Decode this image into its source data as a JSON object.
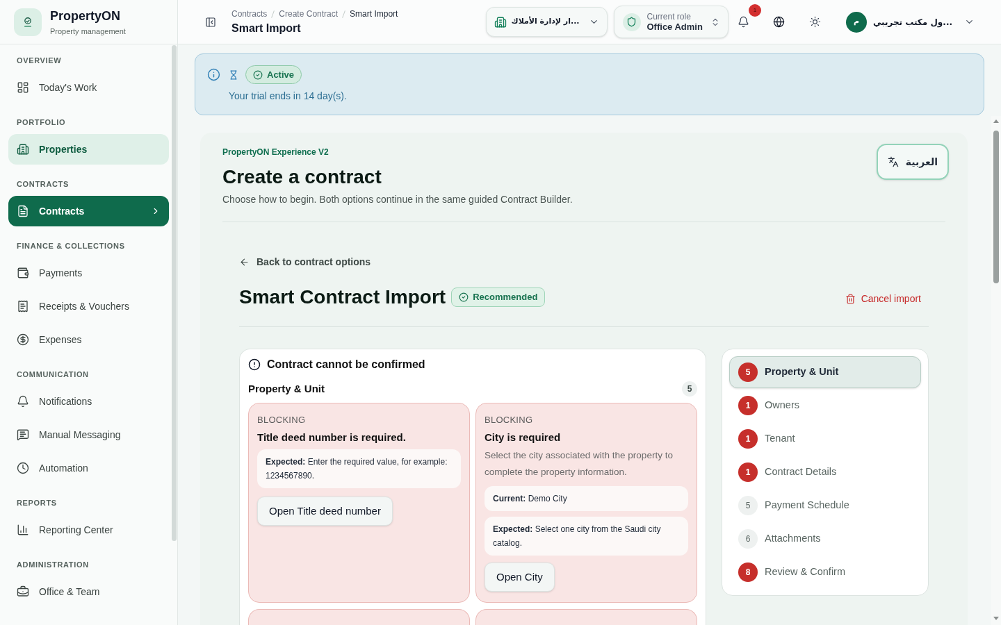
{
  "brand": {
    "name": "PropertyON",
    "tagline": "Property management"
  },
  "sidebar": {
    "sections": [
      {
        "heading": "OVERVIEW",
        "items": [
          {
            "label": "Today's Work",
            "selected": false,
            "highlighted": false
          }
        ]
      },
      {
        "heading": "PORTFOLIO",
        "items": [
          {
            "label": "Properties",
            "selected": false,
            "highlighted": true
          }
        ]
      },
      {
        "heading": "CONTRACTS",
        "items": [
          {
            "label": "Contracts",
            "selected": true,
            "highlighted": false
          }
        ]
      },
      {
        "heading": "FINANCE & COLLECTIONS",
        "items": [
          {
            "label": "Payments",
            "selected": false,
            "highlighted": false
          },
          {
            "label": "Receipts & Vouchers",
            "selected": false,
            "highlighted": false
          },
          {
            "label": "Expenses",
            "selected": false,
            "highlighted": false
          }
        ]
      },
      {
        "heading": "COMMUNICATION",
        "items": [
          {
            "label": "Notifications",
            "selected": false,
            "highlighted": false
          },
          {
            "label": "Manual Messaging",
            "selected": false,
            "highlighted": false
          },
          {
            "label": "Automation",
            "selected": false,
            "highlighted": false
          }
        ]
      },
      {
        "heading": "REPORTS",
        "items": [
          {
            "label": "Reporting Center",
            "selected": false,
            "highlighted": false
          }
        ]
      },
      {
        "heading": "ADMINISTRATION",
        "items": [
          {
            "label": "Office & Team",
            "selected": false,
            "highlighted": false
          }
        ]
      }
    ]
  },
  "header": {
    "breadcrumb": [
      {
        "label": "Contracts",
        "current": false
      },
      {
        "label": "Create Contract",
        "current": false
      },
      {
        "label": "Smart Import",
        "current": true
      }
    ],
    "title": "Smart Import",
    "office_selector": "...ار لإدارة الأملاك",
    "role": {
      "label": "Current role",
      "value": "Office Admin"
    },
    "notification_count": "1",
    "user": {
      "initial": "م",
      "name": "...ول مكتب تجريبي"
    }
  },
  "trial_banner": {
    "status": "Active",
    "message": "Your trial ends in 14 day(s)."
  },
  "page": {
    "eyebrow": "PropertyON Experience V2",
    "title": "Create a contract",
    "subtitle": "Choose how to begin. Both options continue in the same guided Contract Builder.",
    "language_button": "العربية"
  },
  "import": {
    "back_link": "Back to contract options",
    "title": "Smart Contract Import",
    "badge": "Recommended",
    "cancel_button": "Cancel import"
  },
  "validation": {
    "title": "Contract cannot be confirmed",
    "group": {
      "title": "Property & Unit",
      "count": "5"
    },
    "issues": [
      {
        "kind": "issue",
        "severity": "BLOCKING",
        "title": "Title deed number is required.",
        "details": [
          "**Expected:** Enter the required value, for example: 1234567890."
        ],
        "action": "Open Title deed number"
      },
      {
        "kind": "issue",
        "severity": "BLOCKING",
        "title": "City is required",
        "description": "Select the city associated with the property to complete the property information.",
        "details": [
          "**Current:** Demo City",
          "**Expected:** Select one city from the Saudi city catalog."
        ],
        "action": "Open City"
      },
      {
        "kind": "partial"
      },
      {
        "kind": "partial"
      }
    ]
  },
  "steps": [
    {
      "count": "5",
      "label": "Property & Unit",
      "selected": true,
      "blocking": true
    },
    {
      "count": "1",
      "label": "Owners",
      "selected": false,
      "blocking": true
    },
    {
      "count": "1",
      "label": "Tenant",
      "selected": false,
      "blocking": true
    },
    {
      "count": "1",
      "label": "Contract Details",
      "selected": false,
      "blocking": true
    },
    {
      "count": "5",
      "label": "Payment Schedule",
      "selected": false,
      "blocking": false
    },
    {
      "count": "6",
      "label": "Attachments",
      "selected": false,
      "blocking": false
    },
    {
      "count": "8",
      "label": "Review & Confirm",
      "selected": false,
      "blocking": true
    }
  ]
}
